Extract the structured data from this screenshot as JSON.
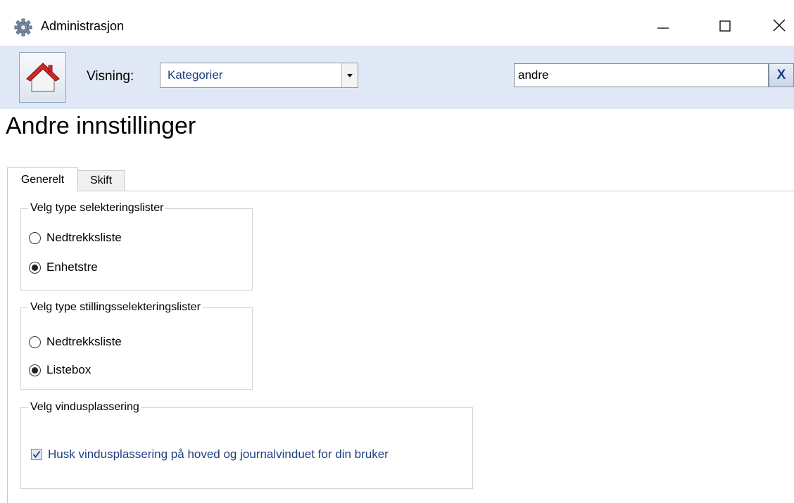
{
  "window": {
    "title": "Administrasjon",
    "controls": {
      "minimize": "minimize-icon",
      "maximize": "maximize-icon",
      "close": "close-icon"
    }
  },
  "toolbar": {
    "home_icon": "home-icon",
    "view_label": "Visning:",
    "view_select": {
      "selected": "Kategorier"
    },
    "search": {
      "value": "andre"
    },
    "clear_label": "X"
  },
  "page": {
    "title": "Andre innstillinger",
    "tabs": [
      {
        "label": "Generelt",
        "active": true
      },
      {
        "label": "Skift",
        "active": false
      }
    ]
  },
  "groups": {
    "selection_lists": {
      "legend": "Velg type selekteringslister",
      "options": [
        {
          "label": "Nedtrekksliste",
          "checked": false
        },
        {
          "label": "Enhetstre",
          "checked": true
        }
      ]
    },
    "position_lists": {
      "legend": "Velg type stillingsselekteringslister",
      "options": [
        {
          "label": "Nedtrekksliste",
          "checked": false
        },
        {
          "label": "Listebox",
          "checked": true
        }
      ]
    },
    "window_placement": {
      "legend": "Velg vindusplassering",
      "checkbox": {
        "label": "Husk vindusplassering på hoved og journalvinduet for din bruker",
        "checked": true
      }
    }
  },
  "colors": {
    "toolbar_bg": "#dfe8f4",
    "link_blue": "#1f3f80",
    "home_red": "#d0282c"
  }
}
